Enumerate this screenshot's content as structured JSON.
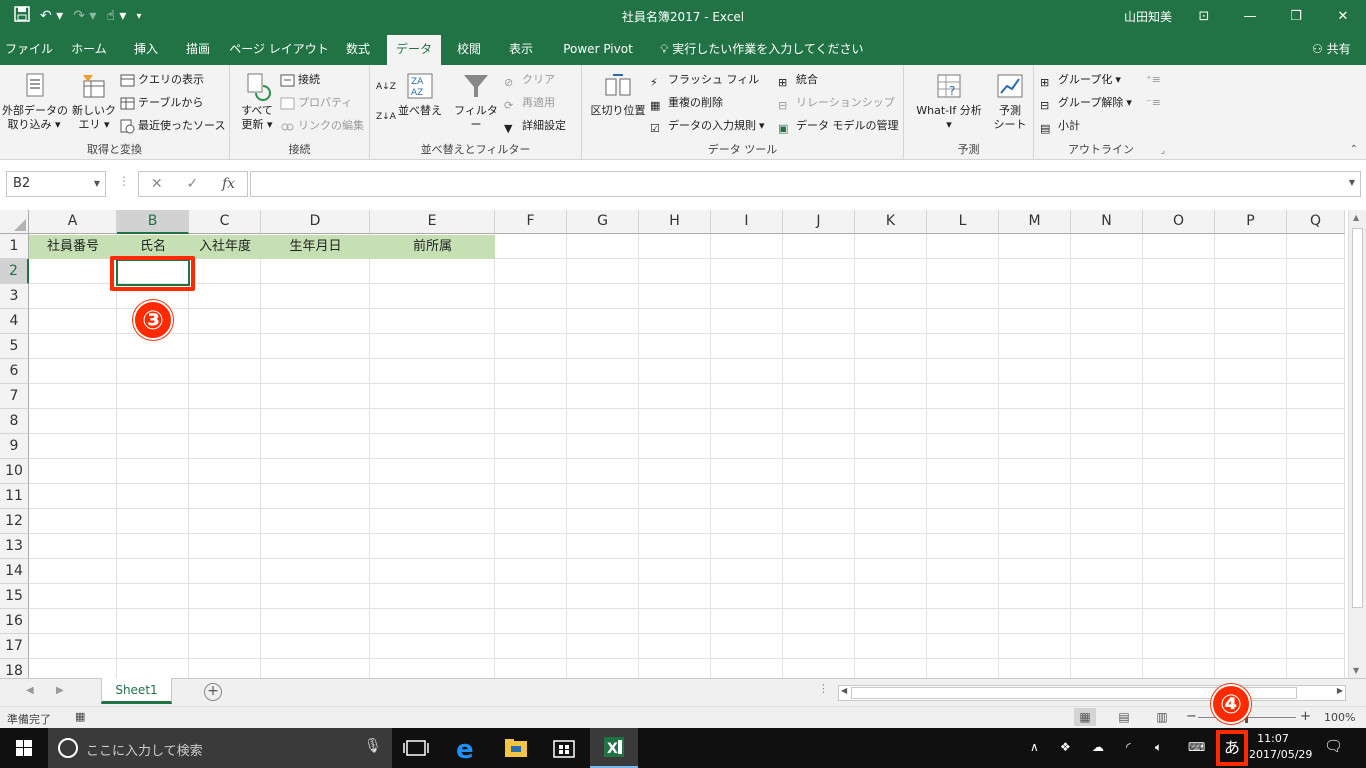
{
  "window": {
    "title": "社員名簿2017 - Excel",
    "user": "山田知美",
    "controls": {
      "ribbon_display": "⊡",
      "minimize": "—",
      "restore": "❐",
      "close": "✕"
    }
  },
  "tabs": [
    {
      "label": "ファイル"
    },
    {
      "label": "ホーム"
    },
    {
      "label": "挿入"
    },
    {
      "label": "描画"
    },
    {
      "label": "ページ レイアウト"
    },
    {
      "label": "数式"
    },
    {
      "label": "データ"
    },
    {
      "label": "校閲"
    },
    {
      "label": "表示"
    },
    {
      "label": "Power Pivot"
    }
  ],
  "tell_me": "実行したい作業を入力してください",
  "share": "共有",
  "ribbon": {
    "get_transform": {
      "label": "取得と変換",
      "external": "外部データの\n取り込み",
      "new_query": "新しいク\nエリ",
      "show_queries": "クエリの表示",
      "from_table": "テーブルから",
      "recent_sources": "最近使ったソース"
    },
    "connections": {
      "label": "接続",
      "refresh_all": "すべて\n更新",
      "connections": "接続",
      "properties": "プロパティ",
      "edit_links": "リンクの編集"
    },
    "sort_filter": {
      "label": "並べ替えとフィルター",
      "sort": "並べ替え",
      "filter": "フィルター",
      "clear": "クリア",
      "reapply": "再適用",
      "advanced": "詳細設定"
    },
    "data_tools": {
      "label": "データ ツール",
      "text_to_columns": "区切り位置",
      "flash_fill": "フラッシュ フィル",
      "remove_duplicates": "重複の削除",
      "validation": "データの入力規則",
      "consolidate": "統合",
      "relationships": "リレーションシップ",
      "manage_model": "データ モデルの管理"
    },
    "forecast": {
      "label": "予測",
      "what_if": "What-If 分析",
      "forecast_sheet": "予測\nシート"
    },
    "outline": {
      "label": "アウトライン",
      "group": "グループ化",
      "ungroup": "グループ解除",
      "subtotal": "小計"
    }
  },
  "formula_bar": {
    "name_box": "B2",
    "value": ""
  },
  "columns": [
    "A",
    "B",
    "C",
    "D",
    "E",
    "F",
    "G",
    "H",
    "I",
    "J",
    "K",
    "L",
    "M",
    "N",
    "O",
    "P",
    "Q"
  ],
  "rows": [
    "1",
    "2",
    "3",
    "4",
    "5",
    "6",
    "7",
    "8",
    "9",
    "10",
    "11",
    "12",
    "13",
    "14",
    "15",
    "16",
    "17",
    "18"
  ],
  "header_cells": [
    "社員番号",
    "氏名",
    "入社年度",
    "生年月日",
    "前所属"
  ],
  "selected_cell": "B2",
  "annotations": {
    "step3": "③",
    "step4": "④"
  },
  "sheet_tab": "Sheet1",
  "status": {
    "ready": "準備完了",
    "zoom": "100%"
  },
  "taskbar": {
    "search_placeholder": "ここに入力して検索",
    "ime": "あ",
    "time": "11:07",
    "date": "2017/05/29"
  },
  "colors": {
    "excel_green": "#217346",
    "header_fill": "#c6e0b4",
    "annotation_red": "#ff2a00"
  }
}
